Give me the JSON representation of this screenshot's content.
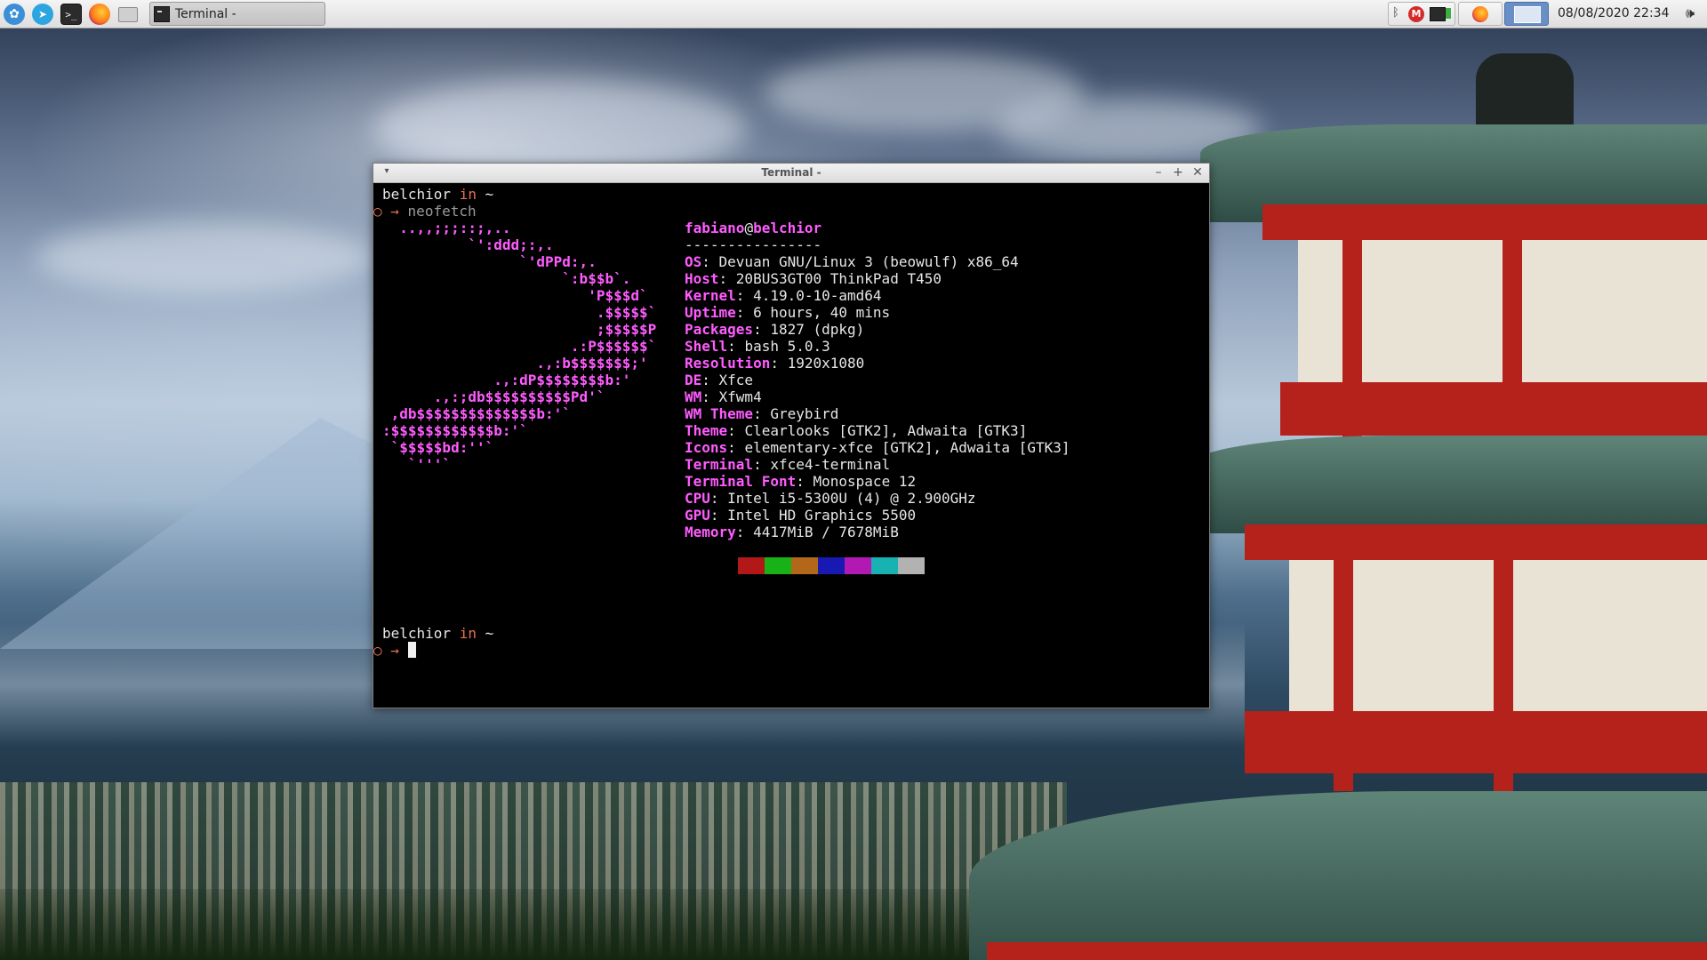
{
  "panel": {
    "launchers": [
      {
        "name": "whisker-menu",
        "icon": "xfce-logo-icon"
      },
      {
        "name": "telegram",
        "icon": "telegram-icon"
      },
      {
        "name": "terminal",
        "icon": "terminal-icon"
      },
      {
        "name": "firefox",
        "icon": "firefox-icon"
      },
      {
        "name": "file-manager",
        "icon": "folder-icon"
      }
    ],
    "task": {
      "label": "Terminal -"
    },
    "clock": "08/08/2020 22:34",
    "colors": {
      "background": "#e6e6e6",
      "accent": "#6a8fc7"
    }
  },
  "terminal": {
    "title": "Terminal -",
    "prompt1_user": "belchior",
    "prompt1_in": "in",
    "prompt1_dir": "~",
    "cmd_marker": "○ →",
    "command": "neofetch",
    "logo_lines": [
      "  ..,,;;;::;,..",
      "          `':ddd;:,.",
      "                `'dPPd:,.",
      "                     `:b$$b`.",
      "                        'P$$$d`",
      "                         .$$$$$`",
      "                         ;$$$$$P",
      "                      .:P$$$$$$`",
      "                  .,:b$$$$$$$;'",
      "             .,:dP$$$$$$$$b:'",
      "      .,:;db$$$$$$$$$$Pd'`",
      " ,db$$$$$$$$$$$$$$b:'`",
      ":$$$$$$$$$$$$b:'`",
      " `$$$$$bd:''`",
      "   `'''`"
    ],
    "userhost": {
      "user": "fabiano",
      "at": "@",
      "host": "belchior"
    },
    "separator": "----------------",
    "info": [
      {
        "key": "OS",
        "value": "Devuan GNU/Linux 3 (beowulf) x86_64"
      },
      {
        "key": "Host",
        "value": "20BUS3GT00 ThinkPad T450"
      },
      {
        "key": "Kernel",
        "value": "4.19.0-10-amd64"
      },
      {
        "key": "Uptime",
        "value": "6 hours, 40 mins"
      },
      {
        "key": "Packages",
        "value": "1827 (dpkg)"
      },
      {
        "key": "Shell",
        "value": "bash 5.0.3"
      },
      {
        "key": "Resolution",
        "value": "1920x1080"
      },
      {
        "key": "DE",
        "value": "Xfce"
      },
      {
        "key": "WM",
        "value": "Xfwm4"
      },
      {
        "key": "WM Theme",
        "value": "Greybird"
      },
      {
        "key": "Theme",
        "value": "Clearlooks [GTK2], Adwaita [GTK3]"
      },
      {
        "key": "Icons",
        "value": "elementary-xfce [GTK2], Adwaita [GTK3]"
      },
      {
        "key": "Terminal",
        "value": "xfce4-terminal"
      },
      {
        "key": "Terminal Font",
        "value": "Monospace 12"
      },
      {
        "key": "CPU",
        "value": "Intel i5-5300U (4) @ 2.900GHz"
      },
      {
        "key": "GPU",
        "value": "Intel HD Graphics 5500"
      },
      {
        "key": "Memory",
        "value": "4417MiB / 7678MiB"
      }
    ],
    "color_blocks": [
      "#000000",
      "#b21818",
      "#18b218",
      "#b26818",
      "#1818b2",
      "#b218b2",
      "#18b2b2",
      "#b2b2b2"
    ],
    "prompt2_user": "belchior",
    "prompt2_in": "in",
    "prompt2_dir": "~",
    "prompt2_marker": "○ →"
  }
}
